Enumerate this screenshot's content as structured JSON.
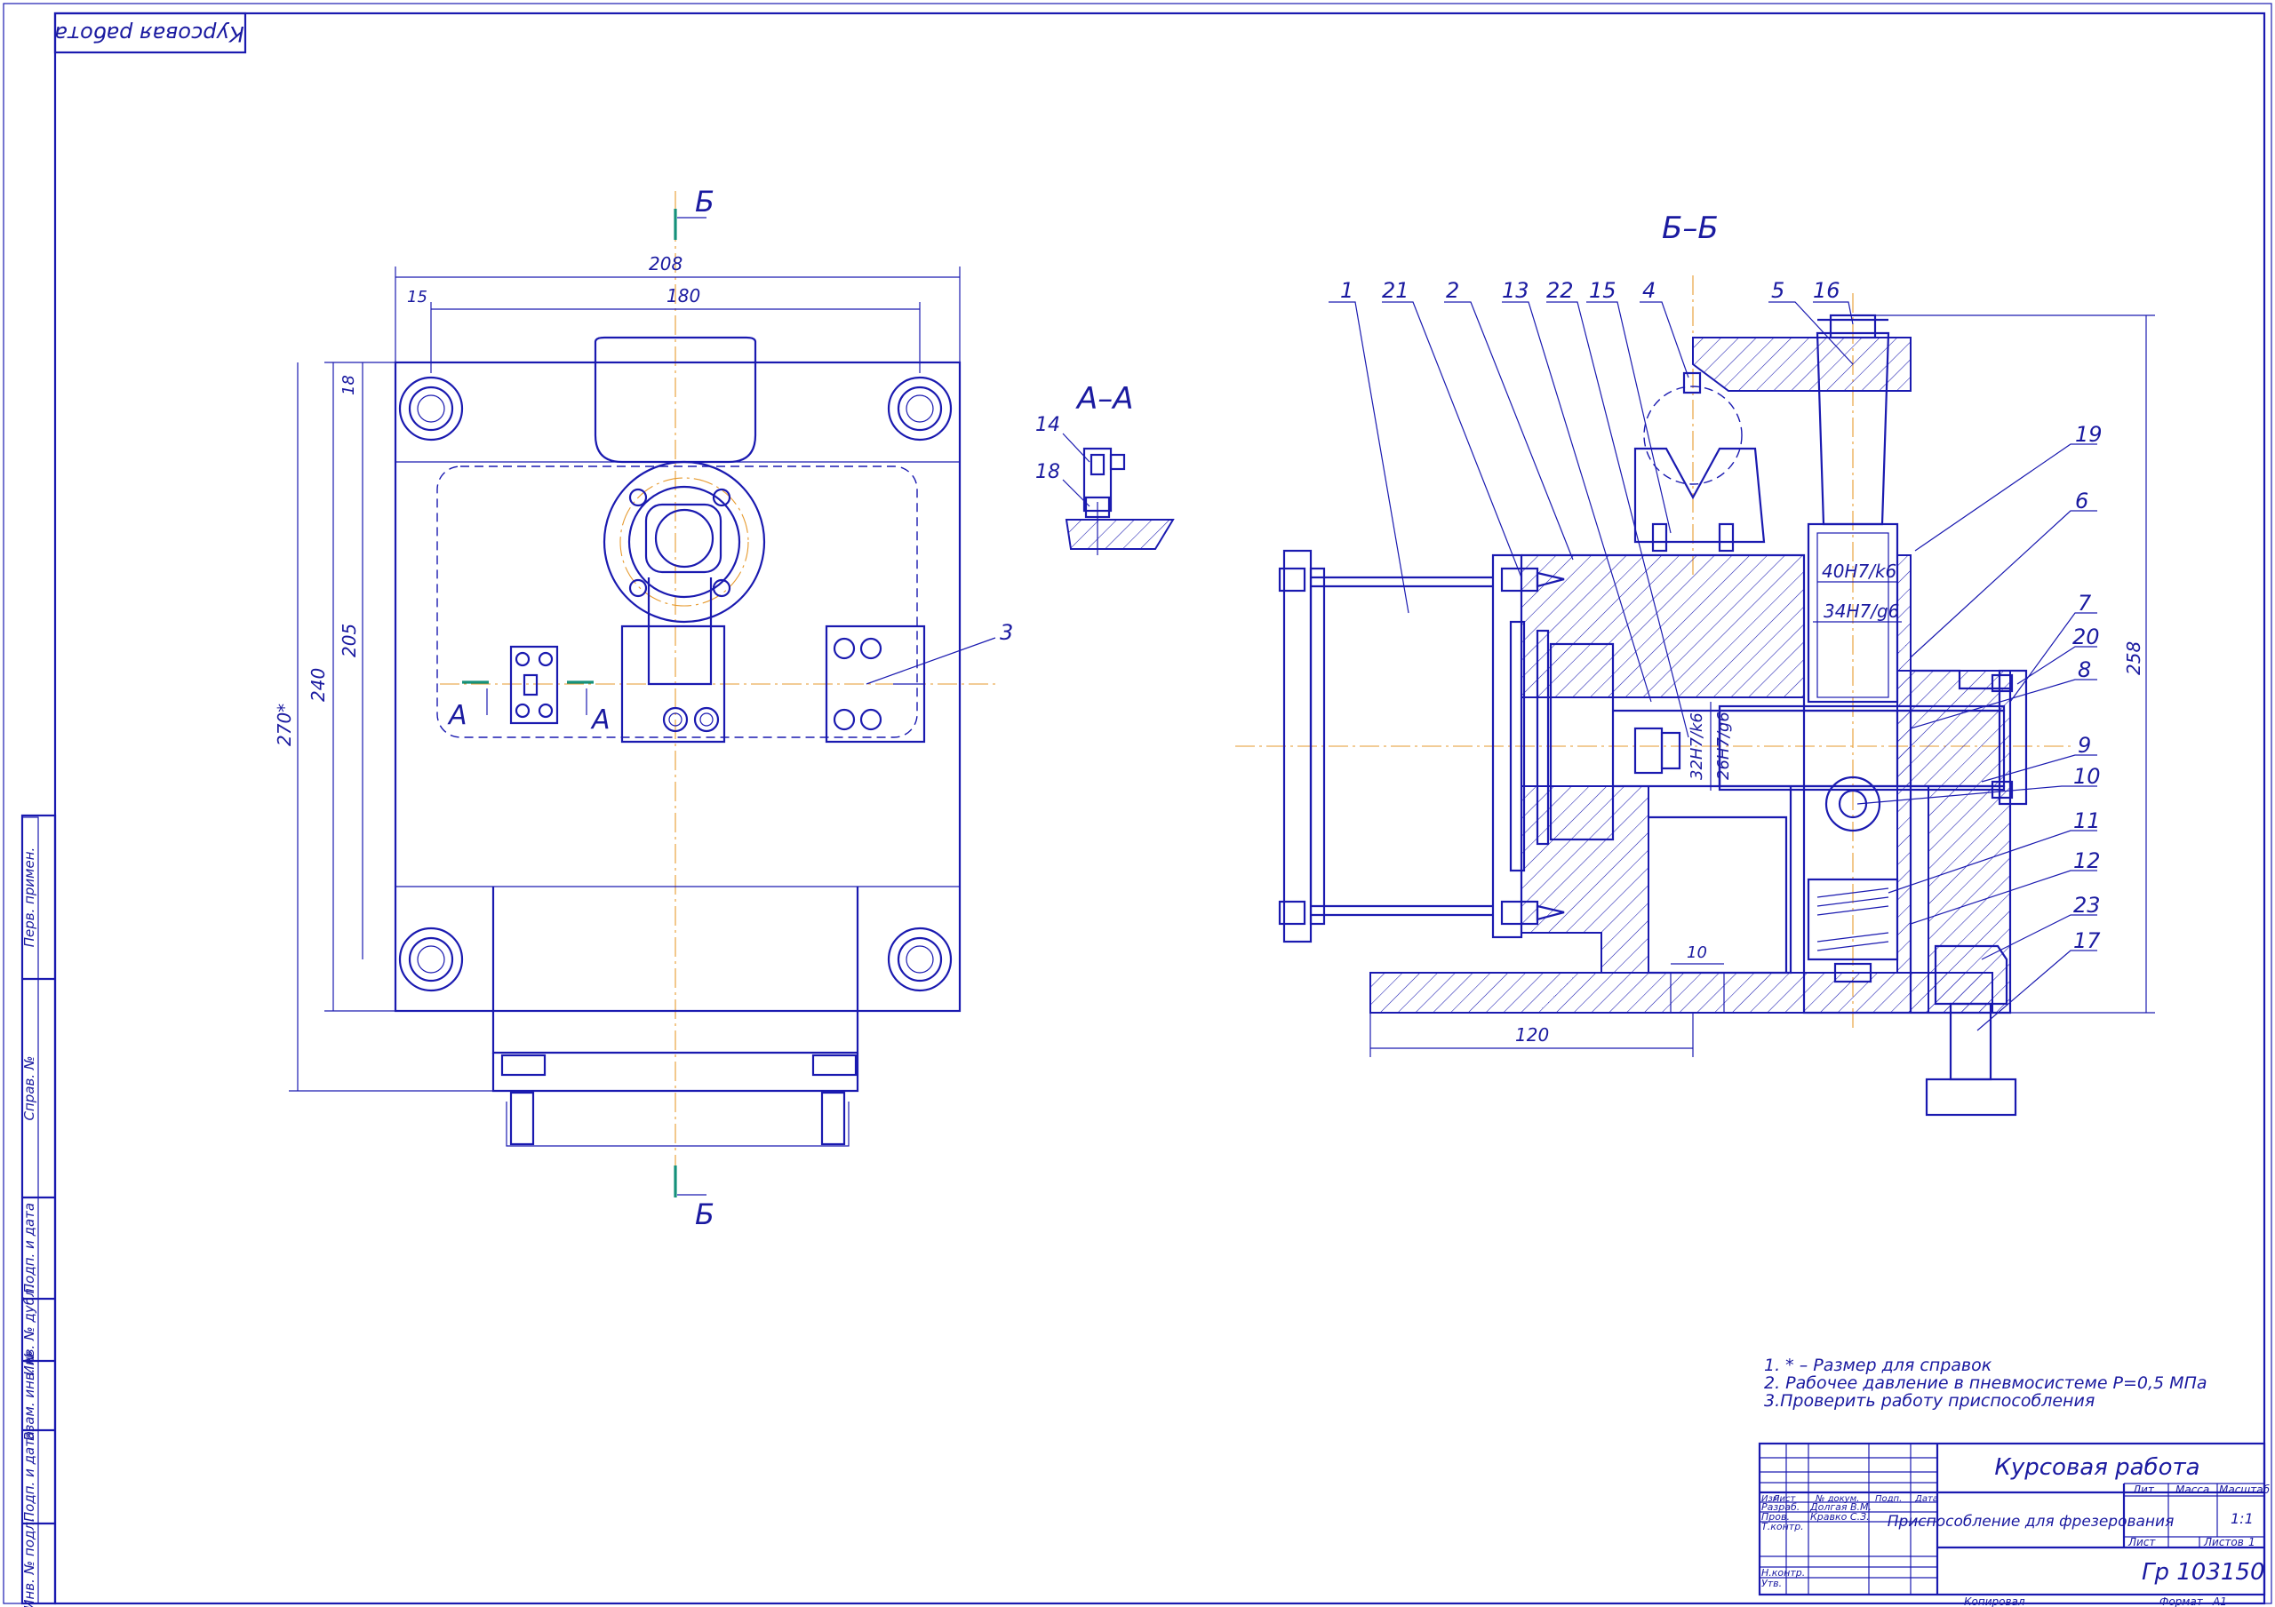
{
  "frame": {
    "stamp_top_left": "Курсовая работа"
  },
  "views": {
    "section_mark": "Б",
    "section_aa": "А–А",
    "section_bb": "Б–Б",
    "mark_a": "А"
  },
  "dimensions_plan": [
    "208",
    "180",
    "15",
    "18",
    "205",
    "240",
    "270*"
  ],
  "dimensions_section": [
    "40H7/k6",
    "34H7/g6",
    "32H7/k6",
    "26H7/g6",
    "258",
    "10",
    "120"
  ],
  "callouts_section": [
    "1",
    "21",
    "2",
    "13",
    "22",
    "15",
    "4",
    "5",
    "16",
    "19",
    "6",
    "7",
    "20",
    "8",
    "9",
    "10",
    "11",
    "12",
    "23",
    "17"
  ],
  "callouts_plan": [
    "3",
    "14",
    "18"
  ],
  "notes": [
    "1. * – Размер для справок",
    "2. Рабочее давление в пневмосистеме Р=0,5 МПа",
    "3.Проверить работу приспособления"
  ],
  "side_strip": [
    "Перв. примен.",
    "Справ. №",
    "Подп. и дата",
    "Инв. № дубл.",
    "Взам. инв. №",
    "Подп. и дата",
    "Инв. № подл."
  ],
  "title_block": {
    "title": "Курсовая работа",
    "name": "Приспособление для фрезерования",
    "header_row": [
      "Изм",
      "Лист",
      "№ докум.",
      "Подп.",
      "Дата"
    ],
    "rows": [
      {
        "role": "Разраб.",
        "person": "Долгая В.М."
      },
      {
        "role": "Пров.",
        "person": "Кравко С.З."
      },
      {
        "role": "Т.контр.",
        "person": ""
      },
      {
        "role": "Н.контр.",
        "person": ""
      },
      {
        "role": "Утв.",
        "person": ""
      }
    ],
    "lit": "Лит.",
    "mass": "Масса",
    "scale": "Масштаб",
    "scale_value": "1:1",
    "sheet": "Лист",
    "sheets": "Листов",
    "sheets_value": "1",
    "code": "Гр 103150",
    "copied": "Копировал",
    "format": "Формат",
    "format_value": "А1"
  }
}
